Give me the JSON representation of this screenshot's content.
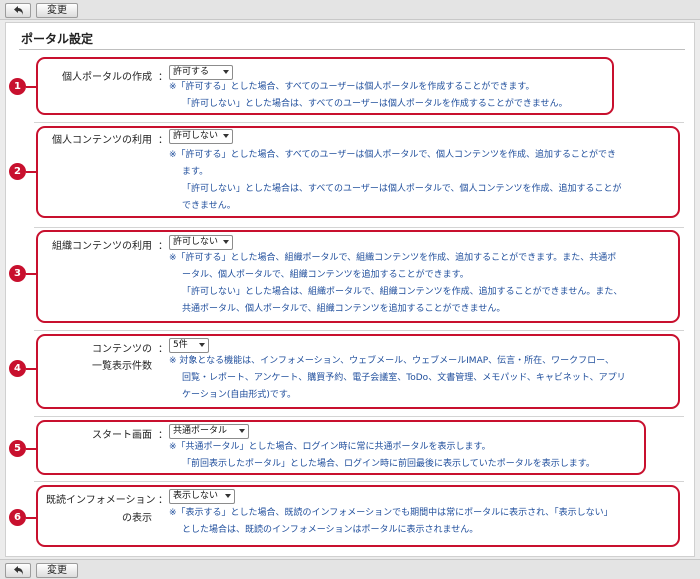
{
  "toolbar": {
    "change_label": "変更"
  },
  "page": {
    "title": "ポータル設定"
  },
  "sections": [
    {
      "number": "1",
      "label": "個人ポータルの作成",
      "colon": "：",
      "select": "許可する",
      "notes": [
        "※「許可する」とした場合、すべてのユーザーは個人ポータルを作成することができます。",
        "「許可しない」とした場合は、すべてのユーザーは個人ポータルを作成することができません。"
      ]
    },
    {
      "number": "2",
      "label": "個人コンテンツの利用",
      "colon": "：",
      "select": "許可しない",
      "notes": [
        "※「許可する」とした場合、すべてのユーザーは個人ポータルで、個人コンテンツを作成、追加することができ",
        "ます。",
        "「許可しない」とした場合は、すべてのユーザーは個人ポータルで、個人コンテンツを作成、追加することが",
        "できません。"
      ]
    },
    {
      "number": "3",
      "label": "組織コンテンツの利用",
      "colon": "：",
      "select": "許可しない",
      "notes": [
        "※「許可する」とした場合、組織ポータルで、組織コンテンツを作成、追加することができます。また、共通ポ",
        "ータル、個人ポータルで、組織コンテンツを追加することができます。",
        "「許可しない」とした場合は、組織ポータルで、組織コンテンツを作成、追加することができません。また、",
        "共通ポータル、個人ポータルで、組織コンテンツを追加することができません。"
      ]
    },
    {
      "number": "4",
      "label_line1": "コンテンツの",
      "label_line2": "一覧表示件数",
      "colon": "：",
      "select": "5件",
      "notes": [
        "※ 対象となる機能は、インフォメーション、ウェブメール、ウェブメールIMAP、伝言・所在、ワークフロー、",
        "回覧・レポート、アンケート、購買予約、電子会議室、ToDo、文書管理、メモパッド、キャビネット、アプリ",
        "ケーション(自由形式)です。"
      ]
    },
    {
      "number": "5",
      "label": "スタート画面",
      "colon": "：",
      "select": "共通ポータル",
      "notes": [
        "※「共通ポータル」とした場合、ログイン時に常に共通ポータルを表示します。",
        "「前回表示したポータル」とした場合、ログイン時に前回最後に表示していたポータルを表示します。"
      ]
    },
    {
      "number": "6",
      "label_line1": "既読インフォメーション",
      "label_line2": "の表示",
      "colon": "：",
      "select": "表示しない",
      "notes": [
        "※「表示する」とした場合、既読のインフォメーションでも期間中は常にポータルに表示され、「表示しない」",
        "とした場合は、既読のインフォメーションはポータルに表示されません。"
      ]
    }
  ]
}
